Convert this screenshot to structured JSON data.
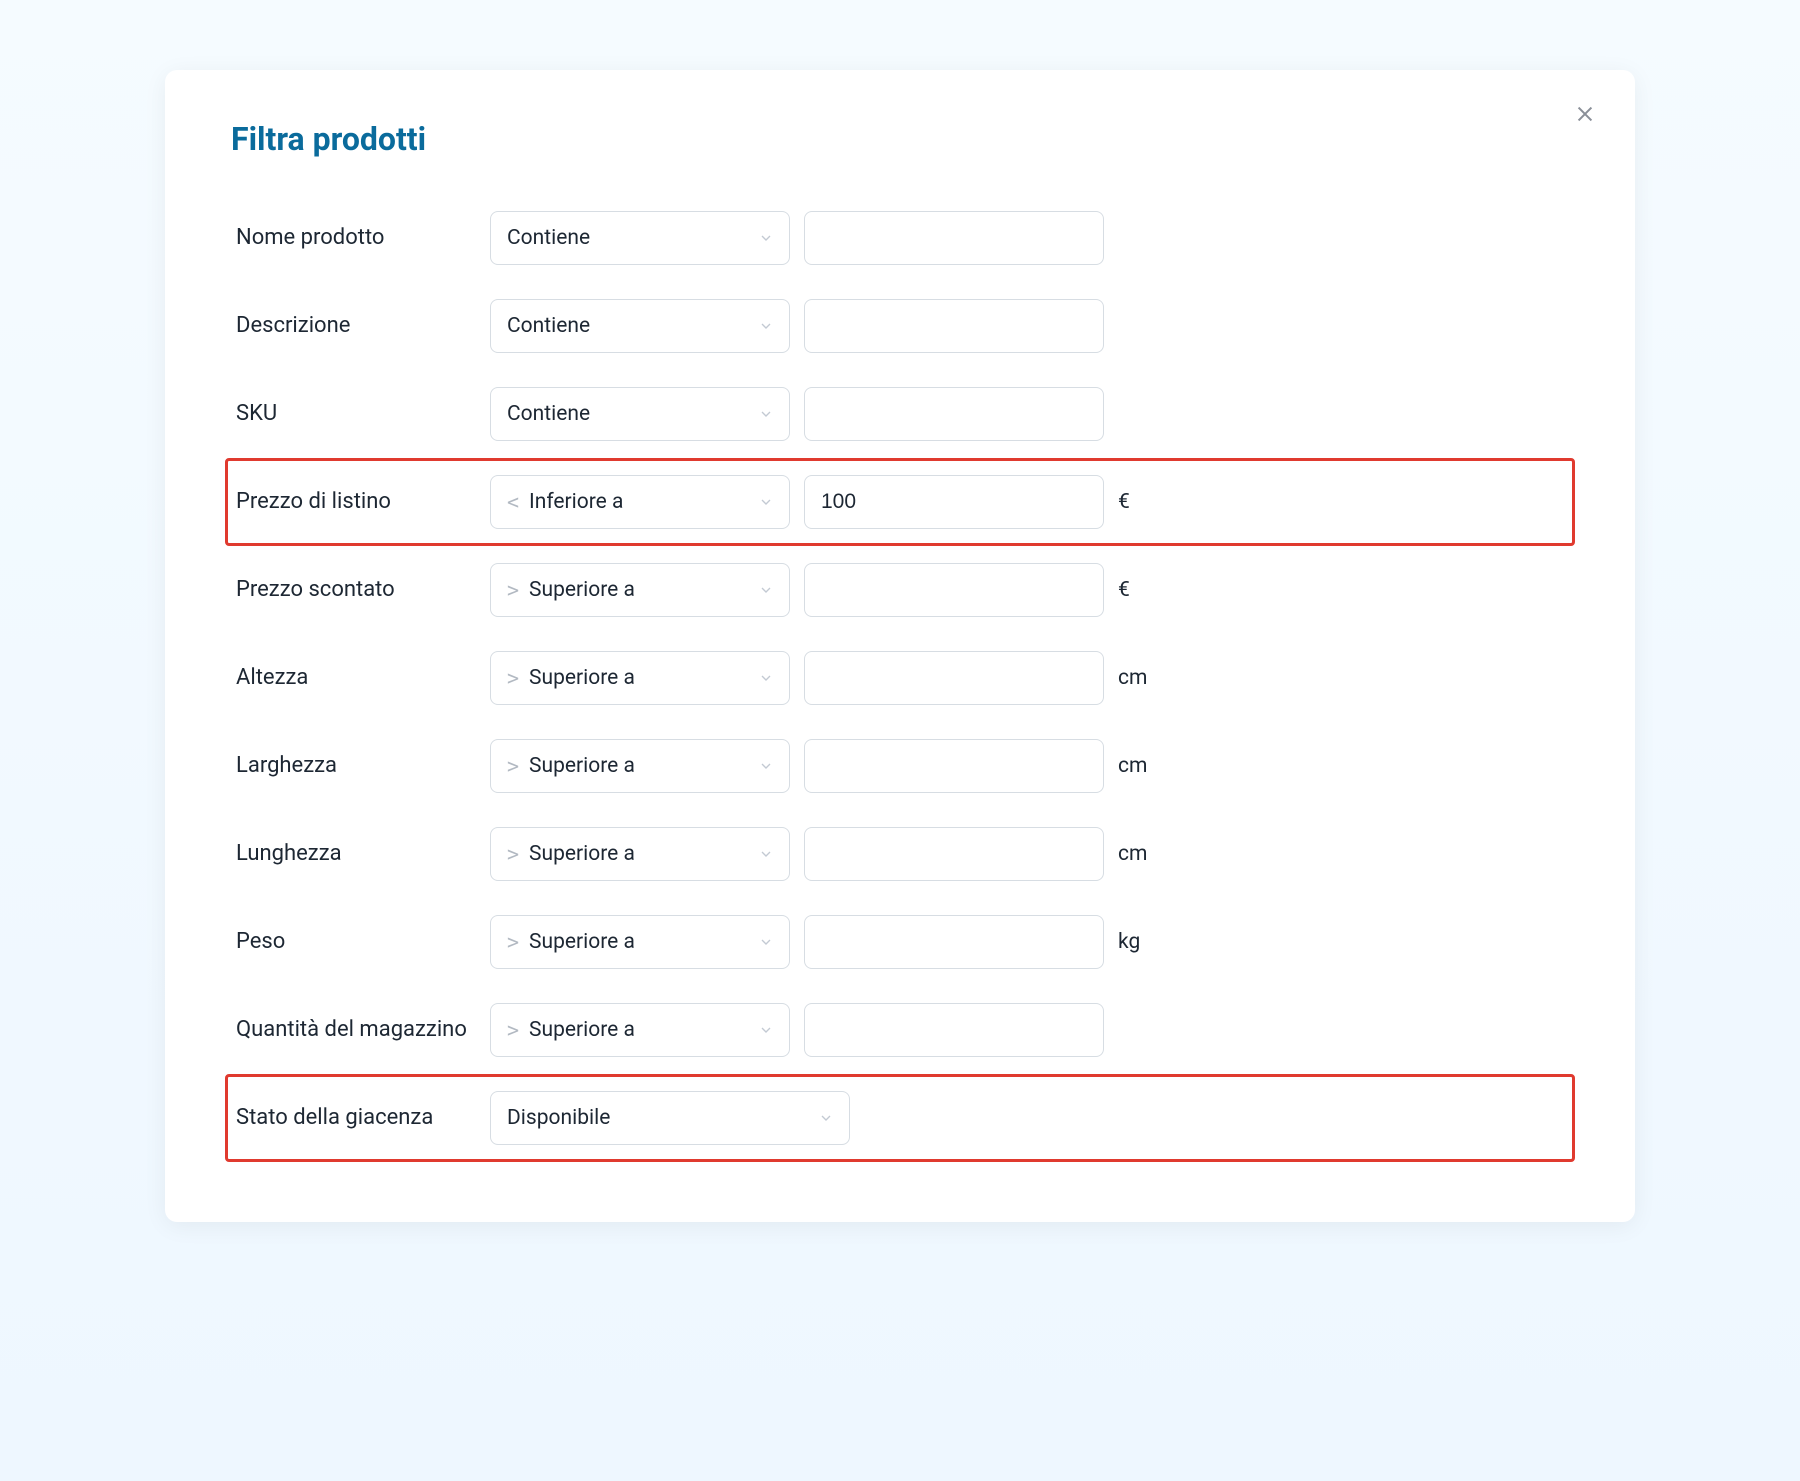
{
  "modal": {
    "title": "Filtra prodotti",
    "close_label": "close"
  },
  "rows": [
    {
      "id": "nome-prodotto",
      "label": "Nome prodotto",
      "op_sym": "",
      "op_text": "Contiene",
      "value": "",
      "unit": "",
      "highlight": false,
      "wide": false
    },
    {
      "id": "descrizione",
      "label": "Descrizione",
      "op_sym": "",
      "op_text": "Contiene",
      "value": "",
      "unit": "",
      "highlight": false,
      "wide": false
    },
    {
      "id": "sku",
      "label": "SKU",
      "op_sym": "",
      "op_text": "Contiene",
      "value": "",
      "unit": "",
      "highlight": false,
      "wide": false
    },
    {
      "id": "prezzo-listino",
      "label": "Prezzo di listino",
      "op_sym": "<",
      "op_text": "Inferiore a",
      "value": "100",
      "unit": "€",
      "highlight": true,
      "wide": false
    },
    {
      "id": "prezzo-scontato",
      "label": "Prezzo scontato",
      "op_sym": ">",
      "op_text": "Superiore a",
      "value": "",
      "unit": "€",
      "highlight": false,
      "wide": false
    },
    {
      "id": "altezza",
      "label": "Altezza",
      "op_sym": ">",
      "op_text": "Superiore a",
      "value": "",
      "unit": "cm",
      "highlight": false,
      "wide": false
    },
    {
      "id": "larghezza",
      "label": "Larghezza",
      "op_sym": ">",
      "op_text": "Superiore a",
      "value": "",
      "unit": "cm",
      "highlight": false,
      "wide": false
    },
    {
      "id": "lunghezza",
      "label": "Lunghezza",
      "op_sym": ">",
      "op_text": "Superiore a",
      "value": "",
      "unit": "cm",
      "highlight": false,
      "wide": false
    },
    {
      "id": "peso",
      "label": "Peso",
      "op_sym": ">",
      "op_text": "Superiore a",
      "value": "",
      "unit": "kg",
      "highlight": false,
      "wide": false
    },
    {
      "id": "quantita",
      "label": "Quantità del magazzino",
      "op_sym": ">",
      "op_text": "Superiore a",
      "value": "",
      "unit": "",
      "highlight": false,
      "wide": false
    },
    {
      "id": "stato-giacenza",
      "label": "Stato della giacenza",
      "op_sym": "",
      "op_text": "Disponibile",
      "value": null,
      "unit": "",
      "highlight": true,
      "wide": true
    }
  ]
}
